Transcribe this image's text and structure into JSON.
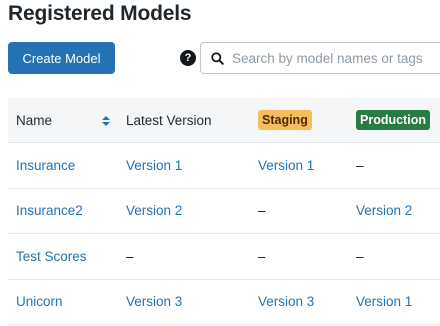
{
  "page": {
    "title": "Registered Models"
  },
  "toolbar": {
    "create_label": "Create Model",
    "help_label": "?",
    "search_placeholder": "Search by model names or tags",
    "search_value": ""
  },
  "table": {
    "headers": {
      "name": "Name",
      "latest": "Latest Version",
      "staging": "Staging",
      "production": "Production"
    },
    "rows": [
      {
        "name": "Insurance",
        "latest": "Version 1",
        "staging": "Version 1",
        "production": "–"
      },
      {
        "name": "Insurance2",
        "latest": "Version 2",
        "staging": "–",
        "production": "Version 2"
      },
      {
        "name": "Test Scores",
        "latest": "–",
        "staging": "–",
        "production": "–"
      },
      {
        "name": "Unicorn",
        "latest": "Version 3",
        "staging": "Version 3",
        "production": "Version 1"
      }
    ]
  },
  "colors": {
    "primary": "#2272b4",
    "staging_badge": "#f5bd5c",
    "production_badge": "#277c43"
  },
  "icons": {
    "search": "search-icon",
    "sort": "sort-icon",
    "help": "help-icon"
  }
}
